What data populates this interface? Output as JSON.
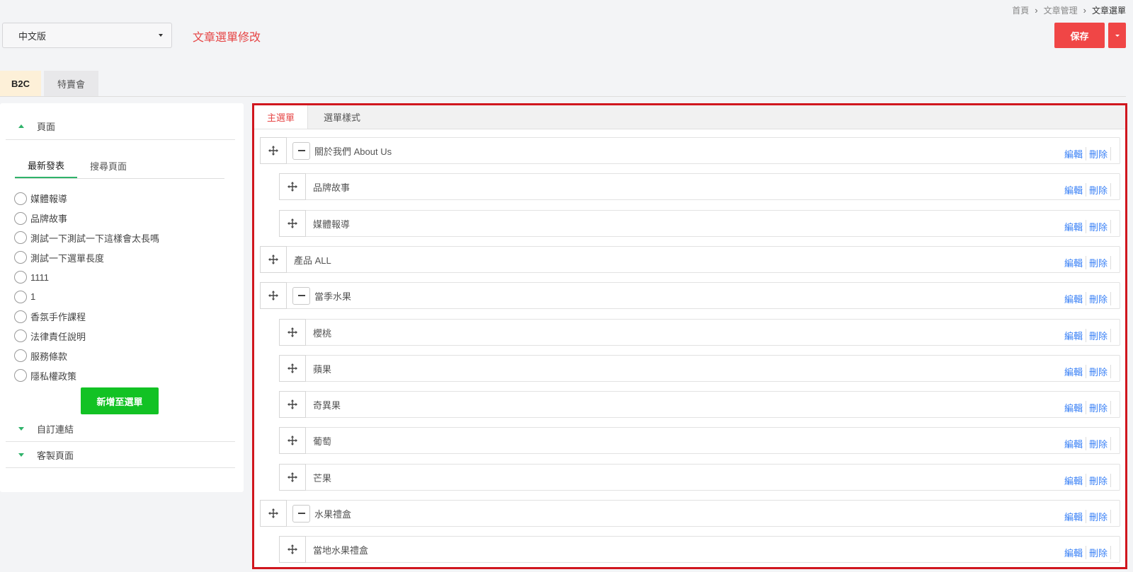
{
  "breadcrumb": {
    "items": [
      "首頁",
      "文章管理",
      "文章選單"
    ]
  },
  "language_select": {
    "value": "中文版"
  },
  "page_title": "文章選單修改",
  "save_button": {
    "label": "保存"
  },
  "store_tabs": [
    {
      "label": "B2C",
      "active": true
    },
    {
      "label": "特賣會",
      "active": false
    }
  ],
  "left_panel": {
    "sections": [
      {
        "label": "頁面",
        "expanded": true
      },
      {
        "label": "自訂連結",
        "expanded": false
      },
      {
        "label": "客製頁面",
        "expanded": false
      }
    ],
    "sub_tabs": [
      {
        "label": "最新發表",
        "active": true
      },
      {
        "label": "搜尋頁面",
        "active": false
      }
    ],
    "options": [
      "媒體報導",
      "品牌故事",
      "測試一下測試一下這樣會太長嗎",
      "測試一下選單長度",
      "1111",
      "1",
      "香氛手作課程",
      "法律責任說明",
      "服務條款",
      "隱私權政策"
    ],
    "add_button": "新增至選單"
  },
  "menu_panel": {
    "tabs": [
      {
        "label": "主選單",
        "active": true
      },
      {
        "label": "選單樣式",
        "active": false
      }
    ],
    "edit_label": "編輯",
    "delete_label": "刪除",
    "items": [
      {
        "label": "關於我們 About Us",
        "level": 0,
        "collapsible": true
      },
      {
        "label": "品牌故事",
        "level": 1,
        "collapsible": false
      },
      {
        "label": "媒體報導",
        "level": 1,
        "collapsible": false
      },
      {
        "label": "產品 ALL",
        "level": 0,
        "collapsible": false
      },
      {
        "label": "當季水果",
        "level": 0,
        "collapsible": true
      },
      {
        "label": "櫻桃",
        "level": 1,
        "collapsible": false
      },
      {
        "label": "蘋果",
        "level": 1,
        "collapsible": false
      },
      {
        "label": "奇異果",
        "level": 1,
        "collapsible": false
      },
      {
        "label": "葡萄",
        "level": 1,
        "collapsible": false
      },
      {
        "label": "芒果",
        "level": 1,
        "collapsible": false
      },
      {
        "label": "水果禮盒",
        "level": 0,
        "collapsible": true
      },
      {
        "label": "當地水果禮盒",
        "level": 1,
        "collapsible": false
      }
    ]
  }
}
